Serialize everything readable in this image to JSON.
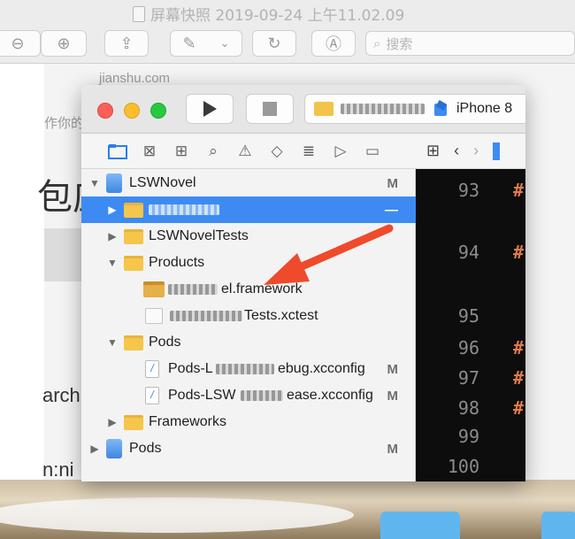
{
  "preview": {
    "title": "屏幕快照 2019-09-24 上午11.02.09",
    "search_placeholder": "搜索",
    "icons": [
      "zoom-out-icon",
      "zoom-in-icon",
      "share-icon",
      "markup-pen-icon",
      "rotate-icon",
      "annotate-icon",
      "search-icon"
    ]
  },
  "page": {
    "url": "jianshu.com",
    "snippet_top": "作你的",
    "snippet_big": "包庄",
    "snippet_arch": "arch",
    "snippet_ni": "n:ni"
  },
  "xcode": {
    "scheme_device": "iPhone 8",
    "navigator_rows": [
      {
        "label": "LSWNovel",
        "badge": "M",
        "type": "project",
        "expanded": true
      },
      {
        "label": "",
        "badge": "—",
        "type": "folder",
        "expanded": false,
        "selected": true
      },
      {
        "label": "LSWNovelTests",
        "badge": "",
        "type": "folder",
        "expanded": false
      },
      {
        "label": "Products",
        "badge": "",
        "type": "folder",
        "expanded": true
      },
      {
        "label": "el.framework",
        "badge": "",
        "type": "framework"
      },
      {
        "label": "Tests.xctest",
        "badge": "",
        "type": "xctest"
      },
      {
        "label": "Pods",
        "badge": "",
        "type": "folder",
        "expanded": true
      },
      {
        "label": "Pods-L",
        "suffix": "ebug.xcconfig",
        "badge": "M",
        "type": "xcconfig"
      },
      {
        "label": "Pods-LSW",
        "suffix": "ease.xcconfig",
        "badge": "M",
        "type": "xcconfig"
      },
      {
        "label": "Frameworks",
        "badge": "",
        "type": "folder",
        "expanded": false
      },
      {
        "label": "Pods",
        "badge": "M",
        "type": "project",
        "expanded": false
      }
    ],
    "line_numbers": [
      "93",
      "94",
      "95",
      "96",
      "97",
      "98",
      "99",
      "100"
    ],
    "hash_char": "#"
  },
  "colors": {
    "selection": "#3d8bf2",
    "arrow": "#ef4a2b",
    "folder": "#f5c64a",
    "editor_bg": "#0d0d0d"
  }
}
